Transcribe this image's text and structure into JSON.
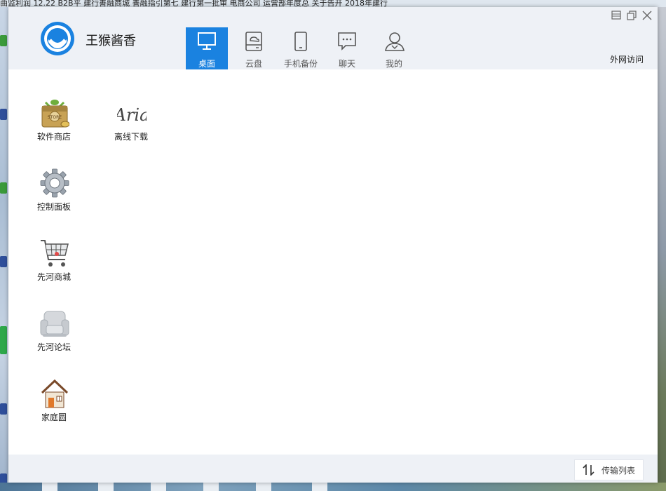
{
  "background": {
    "title_text": "曲监利润 12.22 B2B平 建行善融商城 善融指引第七 建行第一批审   电商公司   运营部年度总   关于告开   2018年建行"
  },
  "window": {
    "user_name": "王猴酱香",
    "nav_tabs": [
      {
        "label": "桌面",
        "icon": "monitor-icon",
        "active": true
      },
      {
        "label": "云盘",
        "icon": "cloud-disk-icon",
        "active": false
      },
      {
        "label": "手机备份",
        "icon": "phone-icon",
        "active": false
      },
      {
        "label": "聊天",
        "icon": "chat-icon",
        "active": false
      },
      {
        "label": "我的",
        "icon": "user-icon",
        "active": false
      }
    ],
    "external_access": "外网访问",
    "window_controls": [
      "minimize-icon",
      "restore-icon",
      "close-icon"
    ]
  },
  "desktop": {
    "apps": [
      {
        "label": "软件商店",
        "icon": "app-store-icon"
      },
      {
        "label": "离线下载",
        "icon": "aria-download-icon"
      },
      {
        "label": "控制面板",
        "icon": "gear-icon"
      },
      {
        "label": "先河商城",
        "icon": "shopping-cart-icon"
      },
      {
        "label": "先河论坛",
        "icon": "sofa-icon"
      },
      {
        "label": "家庭圆",
        "icon": "house-icon"
      }
    ],
    "aria_logo_text": "Aria",
    "store_badge_text": "STORE"
  },
  "footer": {
    "transfer_list": "传输列表"
  },
  "colors": {
    "accent": "#1a82e0",
    "header_bg": "#eef1f6"
  }
}
